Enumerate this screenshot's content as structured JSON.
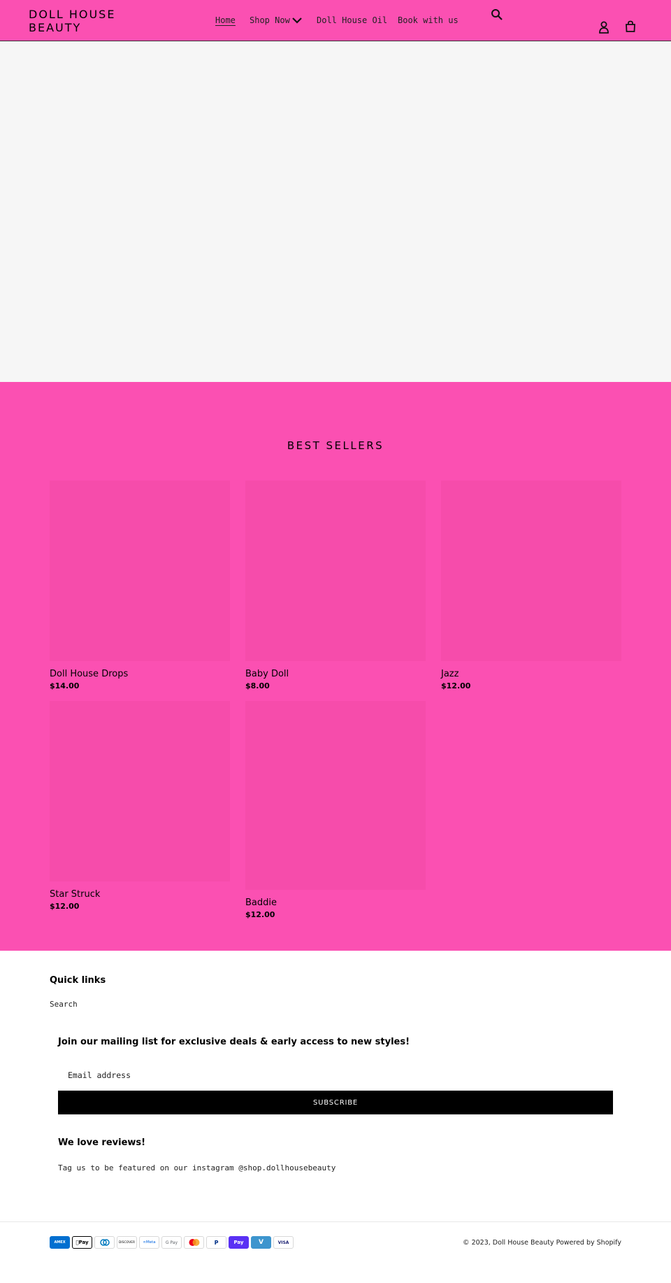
{
  "header": {
    "logo_line1": "DOLL HOUSE",
    "logo_line2": "BEAUTY",
    "nav": [
      {
        "label": "Home"
      },
      {
        "label": "Shop Now"
      },
      {
        "label": "Doll House Oil"
      },
      {
        "label": "Book with us"
      }
    ],
    "icons": [
      "search-icon",
      "account-icon",
      "cart-icon"
    ]
  },
  "best_sellers": {
    "title": "BEST SELLERS",
    "products": [
      {
        "name": "Doll House Drops",
        "price": "$14.00"
      },
      {
        "name": "Baby Doll",
        "price": "$8.00"
      },
      {
        "name": "Jazz",
        "price": "$12.00"
      },
      {
        "name": "Star Struck",
        "price": "$12.00"
      },
      {
        "name": "Baddie",
        "price": "$12.00"
      }
    ]
  },
  "footer": {
    "quick_links_title": "Quick links",
    "quick_links": [
      {
        "label": "Search"
      }
    ],
    "mailing_title": "Join our mailing list for exclusive deals & early access to new styles!",
    "email_placeholder": "Email address",
    "subscribe_label": "SUBSCRIBE",
    "reviews_title": "We love reviews!",
    "reviews_text": "Tag us to be featured on our instagram @shop.dollhousebeauty",
    "payments": [
      "AMEX",
      "Pay",
      "",
      "DISCOVER",
      "Meta",
      "G Pay",
      "",
      "P",
      "Pay",
      "V",
      "VISA"
    ],
    "copyright": "© 2023, Doll House Beauty Powered by Shopify"
  },
  "colors": {
    "brand_pink": "#fb50b2",
    "card_pink": "#f64cab",
    "hero_gray": "#f6f6f6"
  }
}
